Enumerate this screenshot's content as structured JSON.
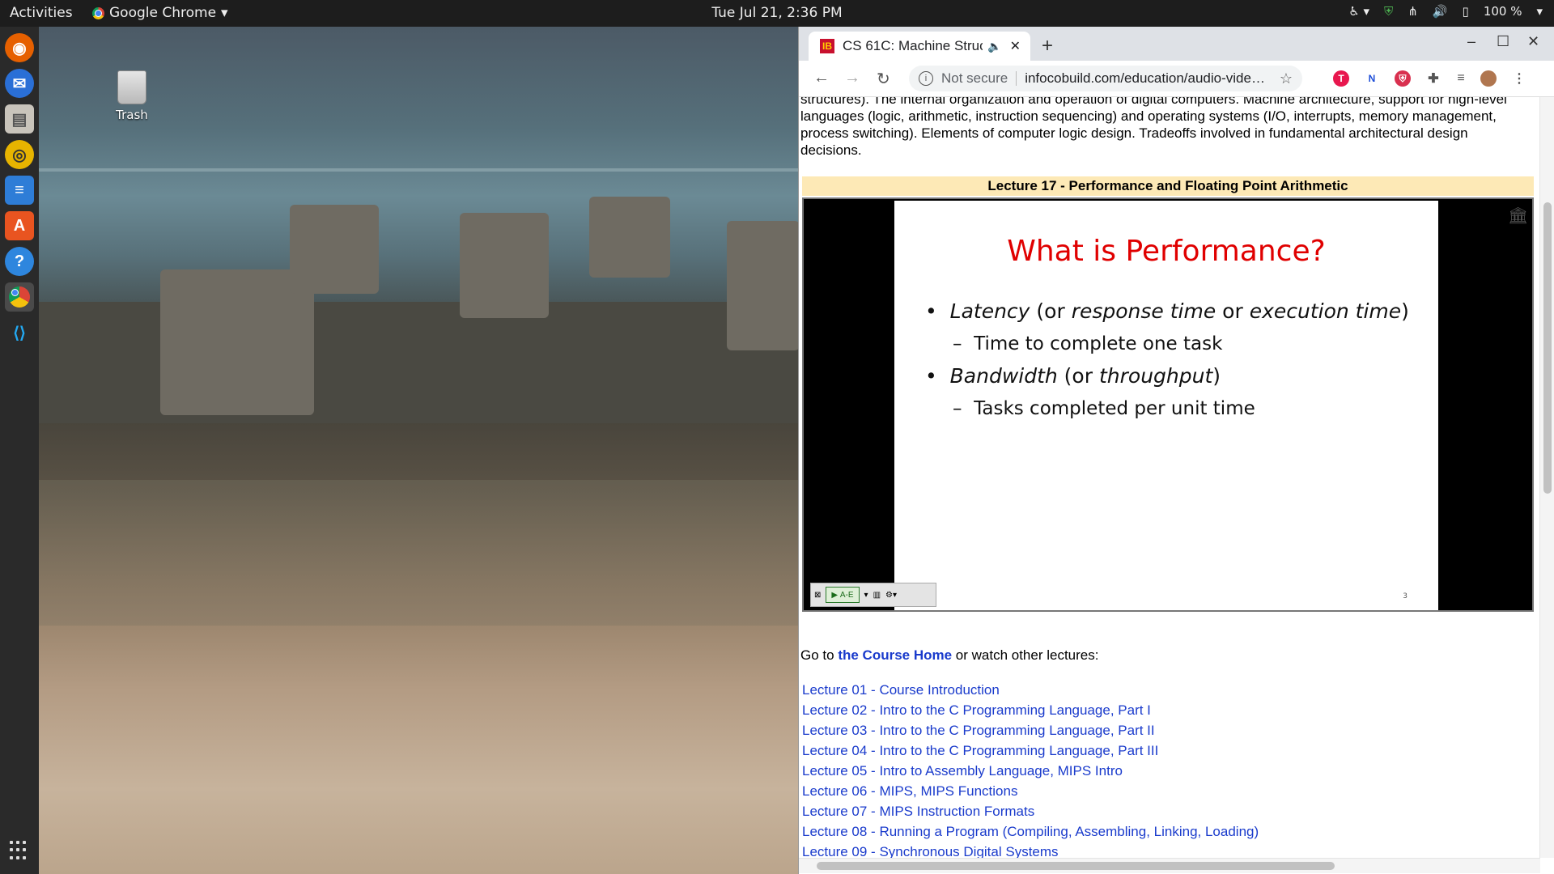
{
  "topbar": {
    "activities": "Activities",
    "app_name": "Google Chrome",
    "clock": "Tue Jul 21,  2:36 PM",
    "battery": "100 %"
  },
  "dock": {
    "items": [
      "firefox-icon",
      "thunderbird-icon",
      "files-icon",
      "rhythmbox-icon",
      "writer-icon",
      "software-icon",
      "help-icon",
      "chrome-icon",
      "vscode-icon"
    ]
  },
  "desktop": {
    "trash_label": "Trash"
  },
  "browser": {
    "tab_title": "CS 61C: Machine Struc",
    "tab_favicon_text": "IB",
    "not_secure": "Not secure",
    "url": "infocobuild.com/education/audio-vide…"
  },
  "page": {
    "description": "structures). The internal organization and operation of digital computers. Machine architecture, support for high-level languages (logic, arithmetic, instruction sequencing) and operating systems (I/O, interrupts, memory management, process switching). Elements of computer logic design. Tradeoffs involved in fundamental architectural design decisions.",
    "lecture_header": "Lecture 17 - Performance and Floating Point Arithmetic",
    "slide": {
      "title": "What is Performance?",
      "b1_term1": "Latency",
      "b1_mid1": " (or ",
      "b1_term2": "response time",
      "b1_mid2": " or ",
      "b1_term3": "execution time",
      "b1_end": ")",
      "b1_sub": "Time to complete one task",
      "b2_term1": "Bandwidth",
      "b2_mid1": " (or ",
      "b2_term2": "throughput",
      "b2_end": ")",
      "b2_sub": "Tasks completed per unit time",
      "page_number": "3"
    },
    "player_button": "A-E",
    "goto_prefix": "Go to ",
    "goto_link": "the Course Home",
    "goto_suffix": " or watch other lectures:",
    "lectures": [
      "Lecture 01 - Course Introduction",
      "Lecture 02 - Intro to the C Programming Language, Part I",
      "Lecture 03 - Intro to the C Programming Language, Part II",
      "Lecture 04 - Intro to the C Programming Language, Part III",
      "Lecture 05 - Intro to Assembly Language, MIPS Intro",
      "Lecture 06 - MIPS, MIPS Functions",
      "Lecture 07 - MIPS Instruction Formats",
      "Lecture 08 - Running a Program (Compiling, Assembling, Linking, Loading)",
      "Lecture 09 - Synchronous Digital Systems"
    ]
  }
}
